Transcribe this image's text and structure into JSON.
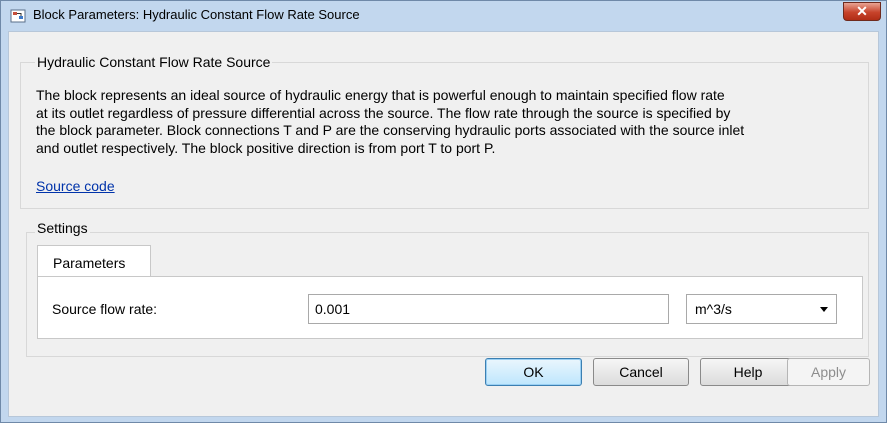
{
  "window": {
    "title": "Block Parameters: Hydraulic Constant Flow Rate Source",
    "close_symbol": "✕"
  },
  "description": {
    "group_title": "Hydraulic Constant Flow Rate Source",
    "lines": [
      "The block represents an ideal source of hydraulic energy that is powerful enough to maintain specified flow rate",
      "at its outlet regardless of pressure differential across the source. The flow rate through the source is specified by",
      "the block parameter. Block connections T and P are the conserving hydraulic ports associated with the source inlet",
      "and outlet respectively. The block positive direction is from port T to port P."
    ],
    "link_label": "Source code"
  },
  "settings": {
    "group_title": "Settings",
    "tabs": [
      {
        "label": "Parameters",
        "active": true
      }
    ],
    "parameters": [
      {
        "label": "Source flow rate:",
        "value": "0.001",
        "unit": "m^3/s"
      }
    ]
  },
  "buttons": {
    "ok": "OK",
    "cancel": "Cancel",
    "help": "Help",
    "apply": "Apply"
  },
  "icons": {
    "app_icon": "simulink-block-icon",
    "close_icon": "close-icon",
    "dropdown_icon": "chevron-down-icon"
  }
}
